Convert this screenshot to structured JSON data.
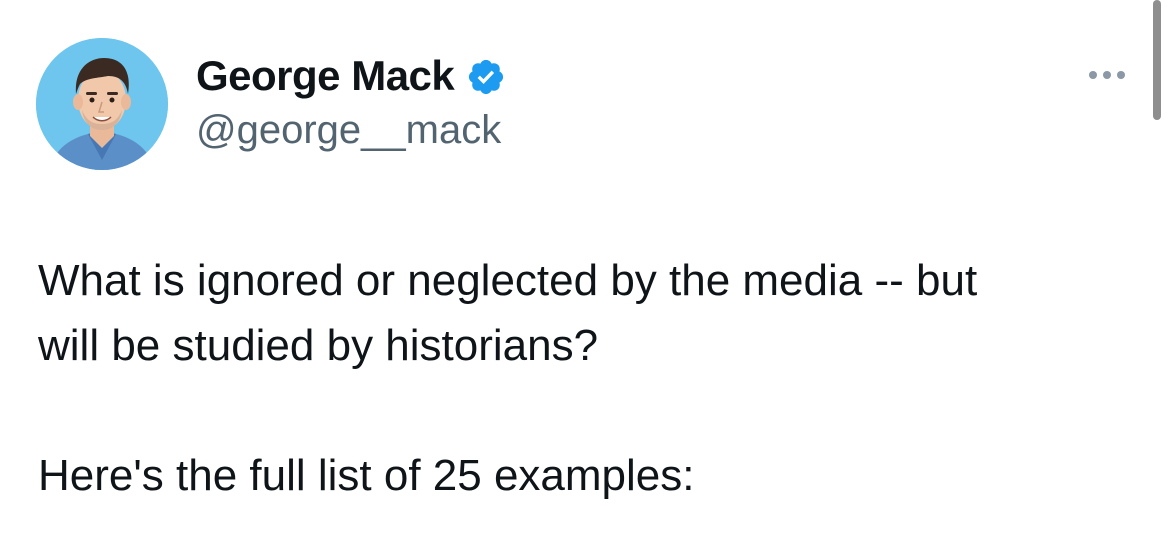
{
  "author": {
    "display_name": "George Mack",
    "handle": "@george__mack",
    "verified": true,
    "avatar_icon": "avatar-illustration",
    "verified_icon": "verified-badge-icon"
  },
  "menu": {
    "icon": "more-horizontal-icon"
  },
  "tweet": {
    "line1": "What is ignored or neglected by the media -- but",
    "line2": "will be studied by historians?",
    "line3": "Here's the full list of 25 examples:"
  },
  "colors": {
    "text": "#0f1419",
    "secondary": "#536471",
    "verified_blue": "#1d9bf0",
    "avatar_bg": "#6ec6ee"
  }
}
